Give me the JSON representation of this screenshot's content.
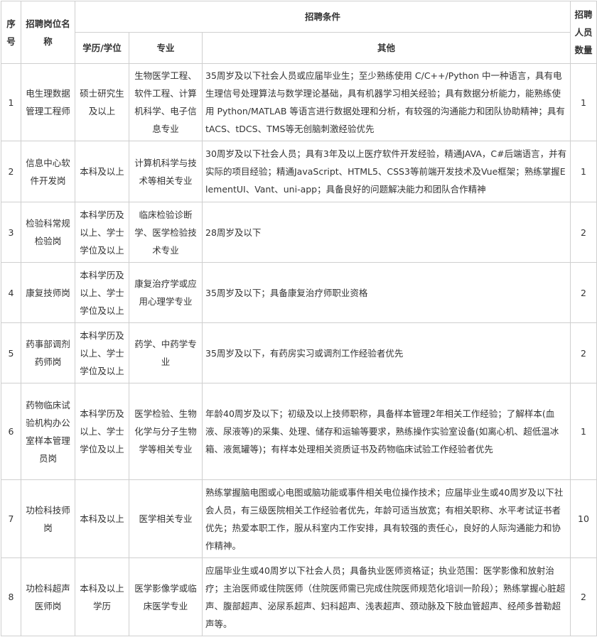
{
  "headers": {
    "seq": "序号",
    "position": "招聘岗位名称",
    "conditions": "招聘条件",
    "education": "学历/学位",
    "major": "专业",
    "other": "其他",
    "count": "招聘人员数量"
  },
  "rows": [
    {
      "seq": "1",
      "position": "电生理数据管理工程师",
      "education": "硕士研究生及以上",
      "major": "生物医学工程、软件工程、计算机科学、电子信息专业",
      "other": "35周岁及以下社会人员或应届毕业生；至少熟练使用 C/C++/Python 中一种语言，具有电生理信号处理算法与数学理论基础，具有机器学习相关经验；具有数据分析能力，能熟练使用 Python/MATLAB 等语言进行数据处理和分析，有较强的沟通能力和团队协助精神；具有tACS、tDCS、TMS等无创脑刺激经验优先",
      "count": "1"
    },
    {
      "seq": "2",
      "position": "信息中心软件开发岗",
      "education": "本科及以上",
      "major": "计算机科学与技术等相关专业",
      "other": "30周岁及以下社会人员；具有3年及以上医疗软件开发经验，精通JAVA，C#后端语言，并有实际的项目经验；精通JavaScript、HTML5、CSS3等前端开发技术及Vue框架；熟练掌握ElementUI、Vant、uni-app；具备良好的问题解决能力和团队合作精神",
      "count": "1"
    },
    {
      "seq": "3",
      "position": "检验科常规检验岗",
      "education": "本科学历及以上、学士学位及以上",
      "major": "临床检验诊断学、医学检验技术专业",
      "other": "28周岁及以下",
      "count": "2"
    },
    {
      "seq": "4",
      "position": "康复技师岗",
      "education": "本科学历及以上、学士学位及以上",
      "major": "康复治疗学或应用心理学专业",
      "other": "35周岁及以下；具备康复治疗师职业资格",
      "count": "2"
    },
    {
      "seq": "5",
      "position": "药事部调剂药师岗",
      "education": "本科学历及以上、学士学位及以上",
      "major": "药学、中药学专业",
      "other": "35周岁及以下，有药房实习或调剂工作经验者优先",
      "count": "2"
    },
    {
      "seq": "6",
      "position": "药物临床试验机构办公室样本管理员岗",
      "education": "本科学历及以上、学士学位及以上",
      "major": "医学检验、生物化学与分子生物学等相关专业",
      "other": "年龄40周岁及以下；初级及以上技师职称，具备样本管理2年相关工作经验；了解样本(血液、尿液等)的采集、处理、储存和运输等要求，熟练操作实验室设备(如离心机、超低温冰箱、液氮罐等)；有样本处理相关资质证书及药物临床试验工作经验者优先",
      "count": "1"
    },
    {
      "seq": "7",
      "position": "功检科技师岗",
      "education": "本科及以上",
      "major": "医学相关专业",
      "other": "熟练掌握脑电图或心电图或脑功能或事件相关电位操作技术；应届毕业生或40周岁及以下社会人员，有三级医院相关工作经验者优先，年龄可适当放宽；有相关职称、水平考试证书者优先；热爱本职工作，服从科室内工作安排，具有较强的责任心，良好的人际沟通能力和协作精神。",
      "count": "10"
    },
    {
      "seq": "8",
      "position": "功检科超声医师岗",
      "education": "本科及以上学历",
      "major": "医学影像学或临床医学专业",
      "other": "应届毕业生或40周岁以下社会人员；具备执业医师资格证；执业范围：医学影像和放射治疗；主治医师或住院医师（住院医师需已完成住院医师规范化培训一阶段）；熟练掌握心脏超声、腹部超声、泌尿系超声、妇科超声、浅表超声、颈动脉及下肢血管超声、经颅多普勒超声等。",
      "count": "2"
    }
  ]
}
